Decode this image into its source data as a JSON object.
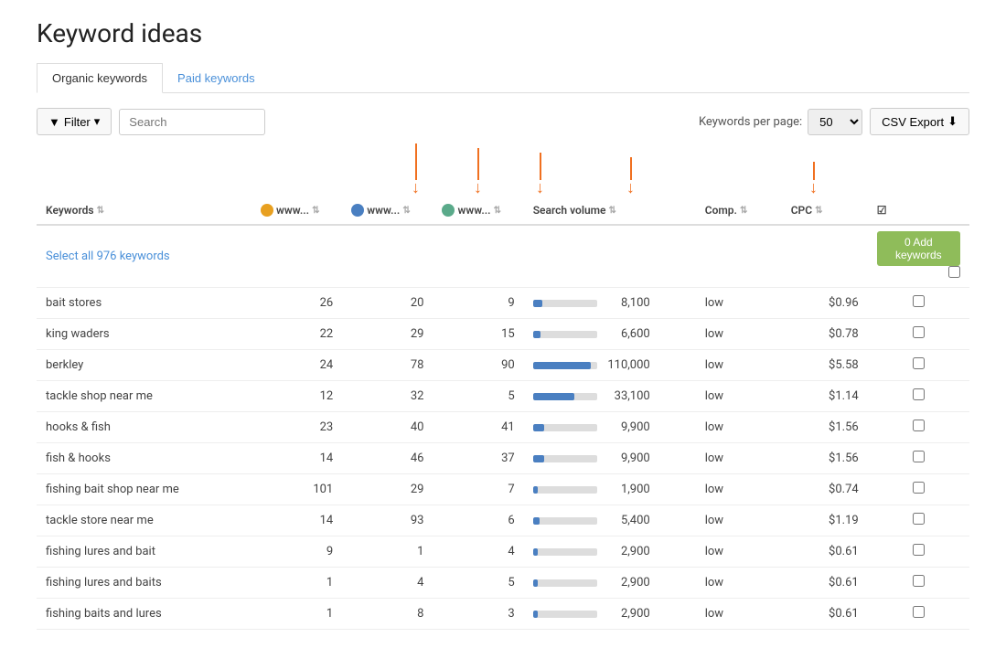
{
  "page": {
    "title": "Keyword ideas",
    "tabs": [
      {
        "label": "Organic keywords",
        "active": true
      },
      {
        "label": "Paid keywords",
        "active": false
      }
    ],
    "toolbar": {
      "filter_label": "Filter",
      "search_placeholder": "Search",
      "keywords_per_page_label": "Keywords per page:",
      "per_page_value": "50",
      "csv_export_label": "CSV Export"
    },
    "table": {
      "select_all_label": "Select all 976 keywords",
      "add_keywords_label": "0 Add keywords",
      "columns": [
        "Keywords",
        "www...",
        "www...",
        "www...",
        "Search volume",
        "Comp.",
        "CPC",
        ""
      ],
      "rows": [
        {
          "keyword": "bait stores",
          "www1": 26,
          "www2": 20,
          "www3": 9,
          "vol": 8100,
          "vol_pct": 15,
          "comp": "low",
          "cpc": "$0.96"
        },
        {
          "keyword": "king waders",
          "www1": 22,
          "www2": 29,
          "www3": 15,
          "vol": 6600,
          "vol_pct": 12,
          "comp": "low",
          "cpc": "$0.78"
        },
        {
          "keyword": "berkley",
          "www1": 24,
          "www2": 78,
          "www3": 90,
          "vol": 110000,
          "vol_pct": 90,
          "comp": "low",
          "cpc": "$5.58"
        },
        {
          "keyword": "tackle shop near me",
          "www1": 12,
          "www2": 32,
          "www3": 5,
          "vol": 33100,
          "vol_pct": 65,
          "comp": "low",
          "cpc": "$1.14"
        },
        {
          "keyword": "hooks & fish",
          "www1": 23,
          "www2": 40,
          "www3": 41,
          "vol": 9900,
          "vol_pct": 18,
          "comp": "low",
          "cpc": "$1.56"
        },
        {
          "keyword": "fish & hooks",
          "www1": 14,
          "www2": 46,
          "www3": 37,
          "vol": 9900,
          "vol_pct": 18,
          "comp": "low",
          "cpc": "$1.56"
        },
        {
          "keyword": "fishing bait shop near me",
          "www1": 101,
          "www2": 29,
          "www3": 7,
          "vol": 1900,
          "vol_pct": 8,
          "comp": "low",
          "cpc": "$0.74"
        },
        {
          "keyword": "tackle store near me",
          "www1": 14,
          "www2": 93,
          "www3": 6,
          "vol": 5400,
          "vol_pct": 10,
          "comp": "low",
          "cpc": "$1.19"
        },
        {
          "keyword": "fishing lures and bait",
          "www1": 9,
          "www2": 1,
          "www3": 4,
          "vol": 2900,
          "vol_pct": 7,
          "comp": "low",
          "cpc": "$0.61"
        },
        {
          "keyword": "fishing lures and baits",
          "www1": 1,
          "www2": 4,
          "www3": 5,
          "vol": 2900,
          "vol_pct": 7,
          "comp": "low",
          "cpc": "$0.61"
        },
        {
          "keyword": "fishing baits and lures",
          "www1": 1,
          "www2": 8,
          "www3": 3,
          "vol": 2900,
          "vol_pct": 7,
          "comp": "low",
          "cpc": "$0.61"
        }
      ]
    }
  }
}
